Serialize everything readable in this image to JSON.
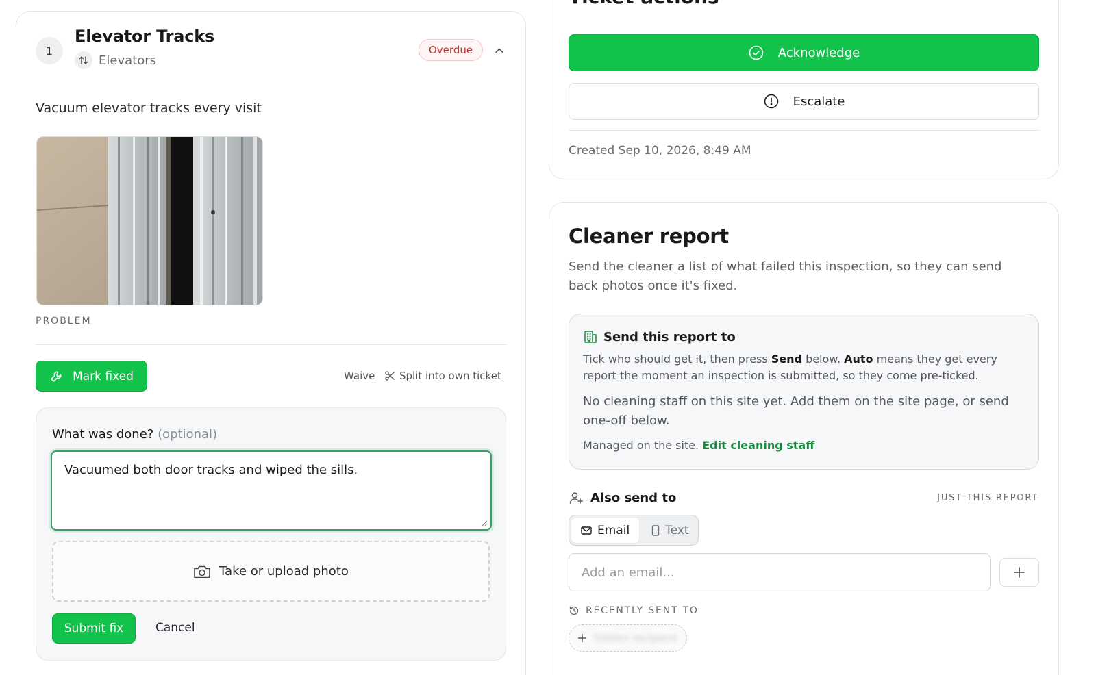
{
  "item": {
    "number": "1",
    "title": "Elevator Tracks",
    "category": "Elevators",
    "status": "Overdue",
    "description": "Vacuum elevator tracks every visit",
    "photo_caption": "PROBLEM",
    "mark_fixed_label": "Mark fixed",
    "waive_label": "Waive",
    "split_label": "Split into own ticket"
  },
  "fix_form": {
    "label": "What was done?",
    "optional_label": "(optional)",
    "textarea_value": "Vacuumed both door tracks and wiped the sills.",
    "upload_label": "Take or upload photo",
    "submit_label": "Submit fix",
    "cancel_label": "Cancel"
  },
  "ticket_actions": {
    "title": "Ticket actions",
    "acknowledge_label": "Acknowledge",
    "escalate_label": "Escalate",
    "created_text": "Created Sep 10, 2026, 8:49 AM"
  },
  "cleaner_report": {
    "title": "Cleaner report",
    "description": "Send the cleaner a list of what failed this inspection, so they can send back photos once it's fixed.",
    "send_to": {
      "heading": "Send this report to",
      "help_1": "Tick who should get it, then press ",
      "help_send": "Send",
      "help_2": " below. ",
      "help_auto": "Auto",
      "help_3": " means they get every report the moment an inspection is submitted, so they come pre-ticked.",
      "no_staff": "No cleaning staff on this site yet. Add them on the site page, or send one-off below.",
      "managed_text": "Managed on the site.",
      "edit_link": "Edit cleaning staff"
    },
    "also_send": {
      "heading": "Also send to",
      "scope_label": "JUST THIS REPORT",
      "tab_email": "Email",
      "tab_text": "Text",
      "active_tab": "Email",
      "email_placeholder": "Add an email...",
      "recent_heading": "RECENTLY SENT TO",
      "recent_chip_text": "hidden recipient"
    }
  },
  "colors": {
    "accent_green": "#12c24b",
    "link_green": "#1a8a3e",
    "overdue_red": "#c8322a"
  }
}
